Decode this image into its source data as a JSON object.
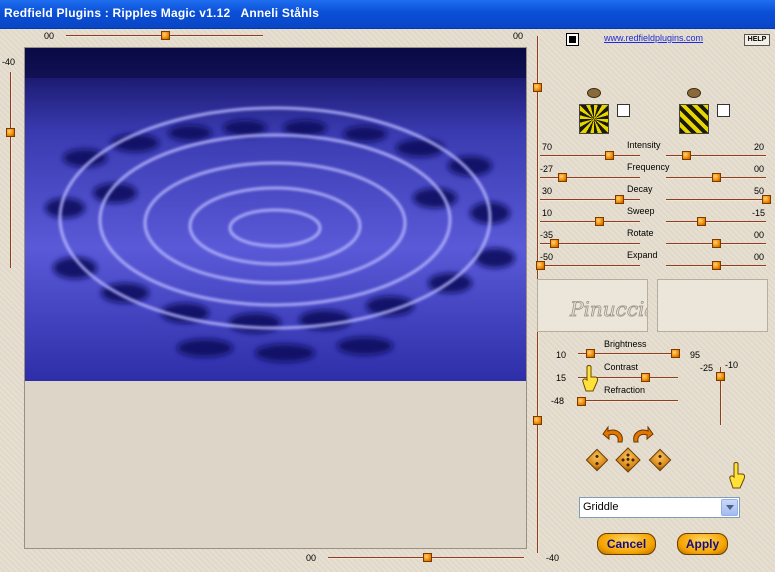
{
  "window": {
    "title": "Redfield Plugins : Ripples Magic v1.12   Anneli Ståhls"
  },
  "header": {
    "link": "www.redfieldplugins.com",
    "help": "HELP"
  },
  "top_slider": {
    "left_value": "00",
    "right_value": "00"
  },
  "left_slider": {
    "value": "-40"
  },
  "bottom_slider": {
    "value": "00"
  },
  "right_vertical_slider": {
    "value": "-40"
  },
  "params": [
    {
      "name": "Intensity",
      "left_value": "70",
      "right_value": "20"
    },
    {
      "name": "Frequency",
      "left_value": "-27",
      "right_value": "00"
    },
    {
      "name": "Decay",
      "left_value": "30",
      "right_value": "50"
    },
    {
      "name": "Sweep",
      "left_value": "10",
      "right_value": "-15"
    },
    {
      "name": "Rotate",
      "left_value": "-35",
      "right_value": "00"
    },
    {
      "name": "Expand",
      "left_value": "-50",
      "right_value": "00"
    }
  ],
  "light": {
    "brightness_label": "Brightness",
    "brightness_left": "10",
    "brightness_right": "95",
    "contrast_label": "Contrast",
    "contrast_value": "15",
    "refraction_label": "Refraction",
    "refraction_value": "-48",
    "vertical_left": "-25",
    "vertical_right": "-10"
  },
  "preset": {
    "selected": "Griddle"
  },
  "buttons": {
    "cancel": "Cancel",
    "apply": "Apply"
  },
  "colors": {
    "accent": "#f5a400",
    "title_bar": "#0a4fd6",
    "ripple_dark": "#1a1a6e",
    "ripple_light": "#8c8cf0"
  },
  "icons": [
    "eye-icon",
    "hand-pointer-icon",
    "undo-arrow-icon",
    "redo-arrow-icon",
    "dice-icon"
  ]
}
